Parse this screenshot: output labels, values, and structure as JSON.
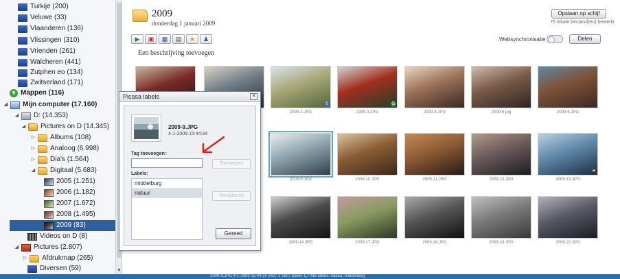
{
  "sidebar": {
    "albums": [
      {
        "label": "Turkije (200)",
        "icon": "album-icon"
      },
      {
        "label": "Veluwe (33)",
        "icon": "album-icon"
      },
      {
        "label": "Vlaanderen (136)",
        "icon": "album-icon"
      },
      {
        "label": "Vlissingen (310)",
        "icon": "album-icon"
      },
      {
        "label": "Vrienden (261)",
        "icon": "album-icon"
      },
      {
        "label": "Walcheren (441)",
        "icon": "album-icon"
      },
      {
        "label": "Zutphen eo (134)",
        "icon": "album-icon"
      },
      {
        "label": "Zwitserland (171)",
        "icon": "album-icon"
      }
    ],
    "mappen_header": "Mappen (116)",
    "tree": [
      {
        "label": "Mijn computer (17.160)",
        "icon": "computer-icon",
        "bold": true
      },
      {
        "label": "D: (14.353)",
        "icon": "drive-icon"
      },
      {
        "label": "Pictures on D (14.345)",
        "icon": "folder-icon"
      },
      {
        "label": "Albums (108)",
        "icon": "folder-icon"
      },
      {
        "label": "Analoog (6.998)",
        "icon": "folder-icon"
      },
      {
        "label": "Dia's (1.564)",
        "icon": "folder-icon"
      },
      {
        "label": "Digitaal (5.683)",
        "icon": "folder-icon"
      },
      {
        "label": "2005 (1.251)",
        "icon": "photo-folder-icon"
      },
      {
        "label": "2006 (1.182)",
        "icon": "photo-folder-icon"
      },
      {
        "label": "2007 (1.672)",
        "icon": "photo-folder-icon"
      },
      {
        "label": "2008 (1.495)",
        "icon": "photo-folder-icon"
      },
      {
        "label": "2009 (83)",
        "icon": "photo-folder-icon",
        "selected": true
      },
      {
        "label": "Videos on D (8)",
        "icon": "video-folder-icon"
      },
      {
        "label": "Pictures (2.807)",
        "icon": "pictures-icon"
      },
      {
        "label": "Afdrukmap (265)",
        "icon": "folder-icon"
      },
      {
        "label": "Diversen (59)",
        "icon": "folder-icon"
      }
    ]
  },
  "main": {
    "folder_title": "2009",
    "folder_date": "donderdag 1 januari 2009",
    "save_button": "Opslaan op schijf",
    "local_status": "75 lokale bestand(en) bewerkt",
    "description_placeholder": "Een beschrijving toevoegen",
    "websync_label": "Websynchronisatie",
    "share_button": "Delen",
    "toolbar_icons": [
      "play-icon",
      "slideshow-icon",
      "collage-icon",
      "movie-icon",
      "star-icon",
      "people-icon"
    ],
    "photos": [
      {
        "caption": "",
        "colors": [
          "#1d1414",
          "#7a2a26",
          "#c9b8a0"
        ]
      },
      {
        "caption": "",
        "colors": [
          "#2a2f3a",
          "#6f7c86",
          "#d8d3c6"
        ]
      },
      {
        "caption": "2009-2.JPG",
        "colors": [
          "#55663a",
          "#a8a777",
          "#d9e3ea"
        ],
        "badge": "up"
      },
      {
        "caption": "2009-3.JPG",
        "colors": [
          "#223f2a",
          "#a32e1f",
          "#cfd6d2"
        ],
        "badge": "G"
      },
      {
        "caption": "2009-4.JPG",
        "colors": [
          "#3a2a22",
          "#9c7158",
          "#e8d8c3"
        ]
      },
      {
        "caption": "2009-5.jpg",
        "colors": [
          "#2e2522",
          "#7a5a48",
          "#cdbcae"
        ]
      },
      {
        "caption": "2009-6.JPG",
        "colors": [
          "#3a2a24",
          "#7e5138",
          "#5f8aa0"
        ]
      },
      {
        "caption": "2009-9.JPG",
        "colors": [
          "#30414c",
          "#8ea4ad",
          "#e9eef1"
        ],
        "selected": true
      },
      {
        "caption": "2009-10.JPG",
        "colors": [
          "#3c2a1a",
          "#8a5c34",
          "#dbc3a0"
        ]
      },
      {
        "caption": "2009-11.JPG",
        "colors": [
          "#2a1a14",
          "#8c5a34",
          "#c58a52"
        ]
      },
      {
        "caption": "2009-12.JPG",
        "colors": [
          "#1e1c22",
          "#6a5a5a",
          "#b39a8a"
        ]
      },
      {
        "caption": "2009-13.JPG",
        "colors": [
          "#1c3044",
          "#5e88a8",
          "#b8d0e0"
        ],
        "badge": "star"
      },
      {
        "caption": "2009-14.JPG",
        "colors": [
          "#141414",
          "#4a4a4a",
          "#cfcfcf"
        ]
      },
      {
        "caption": "2009-17.JPG",
        "colors": [
          "#2a3a22",
          "#8a9a62",
          "#c59aa0"
        ]
      },
      {
        "caption": "2009-18.JPG",
        "colors": [
          "#111111",
          "#555555",
          "#aaaaaa"
        ]
      },
      {
        "caption": "2009-19.JPG",
        "colors": [
          "#3a3a3a",
          "#7a7a7a",
          "#c0c0c0"
        ]
      },
      {
        "caption": "2009-20.JPG",
        "colors": [
          "#1c1c24",
          "#5a5a66",
          "#b2b2bc"
        ]
      }
    ],
    "status_strip": "2009-9.JPG  4-1-2009 15:44:34  2427 x 1807 pixels  1,7 MB  labels: natuur, middelburg"
  },
  "dialog": {
    "title": "Picasa labels",
    "filename": "2009-9.JPG",
    "filedate": "4-1-2009 15:44:34",
    "tag_label": "Tag toevoegen:",
    "tag_input_value": "",
    "add_button": "Toevoegen",
    "labels_label": "Labels:",
    "labels": [
      "middelburg",
      "natuur"
    ],
    "remove_button": "Verwijderen",
    "cancel_button": "Gereed"
  },
  "colors": {
    "selection": "#2e5e9e",
    "accent_arrow": "#e0201a",
    "status_strip": "#2a6fa8"
  }
}
